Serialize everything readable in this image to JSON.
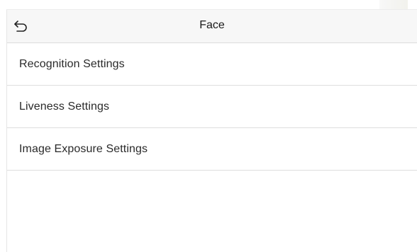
{
  "header": {
    "title": "Face",
    "back_icon": "back-arrow-icon"
  },
  "menu": {
    "items": [
      {
        "label": "Recognition Settings"
      },
      {
        "label": "Liveness Settings"
      },
      {
        "label": "Image Exposure Settings"
      }
    ]
  },
  "colors": {
    "background": "#ffffff",
    "divider": "#dedede",
    "text": "#2a2a2a"
  }
}
